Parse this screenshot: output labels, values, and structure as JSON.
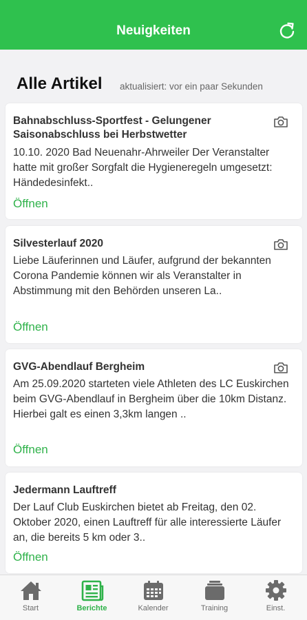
{
  "header": {
    "title": "Neuigkeiten",
    "refresh_icon": "refresh-icon"
  },
  "section": {
    "title": "Alle Artikel",
    "updated": "aktualisiert: vor ein paar Sekunden"
  },
  "articles": [
    {
      "title": "Bahnabschluss-Sportfest - Gelungener Saisonabschluss bei Herbstwetter",
      "excerpt": "10.10. 2020 Bad Neuenahr-Ahrweiler Der Veranstalter hatte mit großer Sorgfalt die Hygieneregeln umgesetzt: Händedesinfekt..",
      "open_label": "Öffnen",
      "has_photo": true
    },
    {
      "title": "Silvesterlauf 2020",
      "excerpt": "Liebe Läuferinnen und Läufer, aufgrund der bekannten Corona Pandemie können wir als Veranstalter in Abstimmung mit den Behörden unseren La..",
      "open_label": "Öffnen",
      "has_photo": true
    },
    {
      "title": "GVG-Abendlauf Bergheim",
      "excerpt": "Am 25.09.2020 starteten viele Athleten des LC Euskirchen beim GVG-Abendlauf in Bergheim über die 10km Distanz. Hierbei galt es einen 3,3km langen ..",
      "open_label": "Öffnen",
      "has_photo": true
    },
    {
      "title": "Jedermann Lauftreff",
      "excerpt": "Der Lauf Club Euskirchen bietet ab Freitag, den 02. Oktober 2020, einen Lauftreff für alle interessierte Läufer an, die bereits 5 km oder 3..",
      "open_label": "Öffnen",
      "has_photo": false
    }
  ],
  "tabs": [
    {
      "label": "Start",
      "icon": "home-icon",
      "active": false
    },
    {
      "label": "Berichte",
      "icon": "news-icon",
      "active": true
    },
    {
      "label": "Kalender",
      "icon": "calendar-icon",
      "active": false
    },
    {
      "label": "Training",
      "icon": "training-icon",
      "active": false
    },
    {
      "label": "Einst.",
      "icon": "gear-icon",
      "active": false
    }
  ],
  "colors": {
    "brand_green": "#2fc14e",
    "link_green": "#2fb24a",
    "inactive_tab": "#6b6b6b"
  }
}
